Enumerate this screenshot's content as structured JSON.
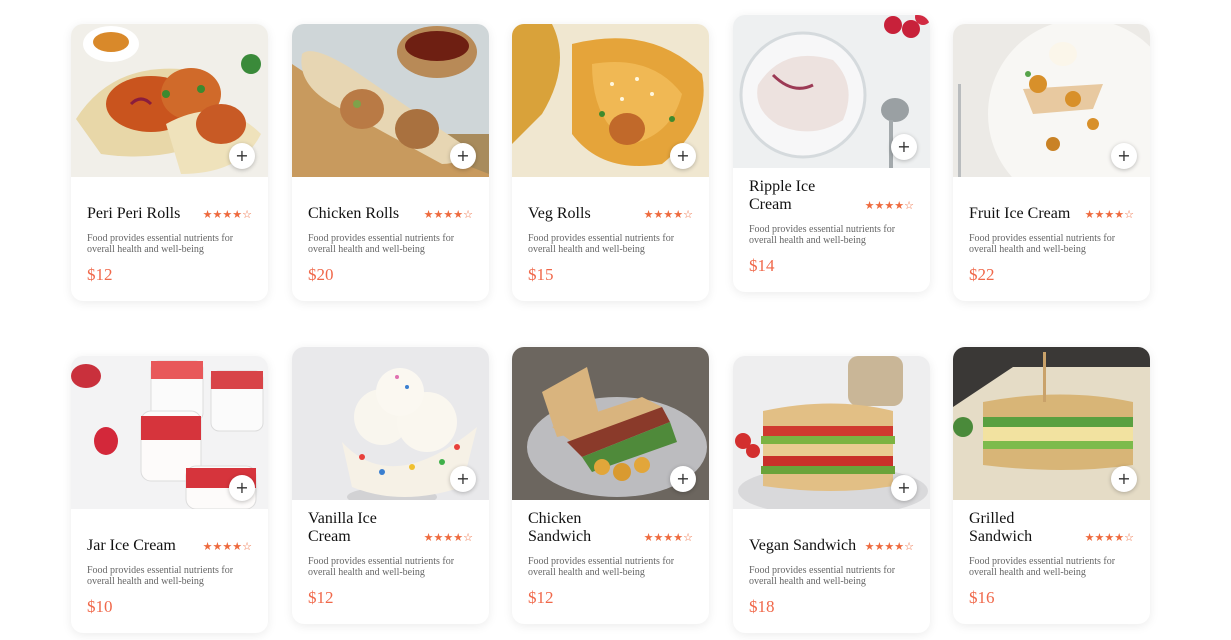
{
  "add_label": "+",
  "rating_stars": {
    "filled": "★★★★",
    "empty": "☆"
  },
  "colors": {
    "accent": "#f0684a",
    "star": "#ee6a3e"
  },
  "products": [
    {
      "name": "Peri Peri Rolls",
      "desc": "Food provides essential nutrients for overall health and well-being",
      "price": "$12",
      "rating": 4,
      "image_icon": "wrap-roll-photo"
    },
    {
      "name": "Chicken Rolls",
      "desc": "Food provides essential nutrients for overall health and well-being",
      "price": "$20",
      "rating": 4,
      "image_icon": "burrito-photo"
    },
    {
      "name": "Veg Rolls",
      "desc": "Food provides essential nutrients for overall health and well-being",
      "price": "$15",
      "rating": 4,
      "image_icon": "pastry-roll-photo"
    },
    {
      "name": "Ripple Ice Cream",
      "desc": "Food provides essential nutrients for overall health and well-being",
      "price": "$14",
      "rating": 4,
      "image_icon": "ice-cream-jar-photo"
    },
    {
      "name": "Fruit Ice Cream",
      "desc": "Food provides essential nutrients for overall health and well-being",
      "price": "$22",
      "rating": 4,
      "image_icon": "plated-dessert-photo"
    },
    {
      "name": "Jar Ice Cream",
      "desc": "Food provides essential nutrients for overall health and well-being",
      "price": "$10",
      "rating": 4,
      "image_icon": "dessert-jars-photo"
    },
    {
      "name": "Vanilla Ice Cream",
      "desc": "Food provides essential nutrients for overall health and well-being",
      "price": "$12",
      "rating": 4,
      "image_icon": "sprinkle-ice-cream-photo"
    },
    {
      "name": "Chicken Sandwich",
      "desc": "Food provides essential nutrients for overall health and well-being",
      "price": "$12",
      "rating": 4,
      "image_icon": "sandwich-plate-photo"
    },
    {
      "name": "Vegan Sandwich",
      "desc": "Food provides essential nutrients for overall health and well-being",
      "price": "$18",
      "rating": 4,
      "image_icon": "stacked-sandwich-photo"
    },
    {
      "name": "Grilled Sandwich",
      "desc": "Food provides essential nutrients for overall health and well-being",
      "price": "$16",
      "rating": 4,
      "image_icon": "grilled-sandwich-photo"
    }
  ]
}
